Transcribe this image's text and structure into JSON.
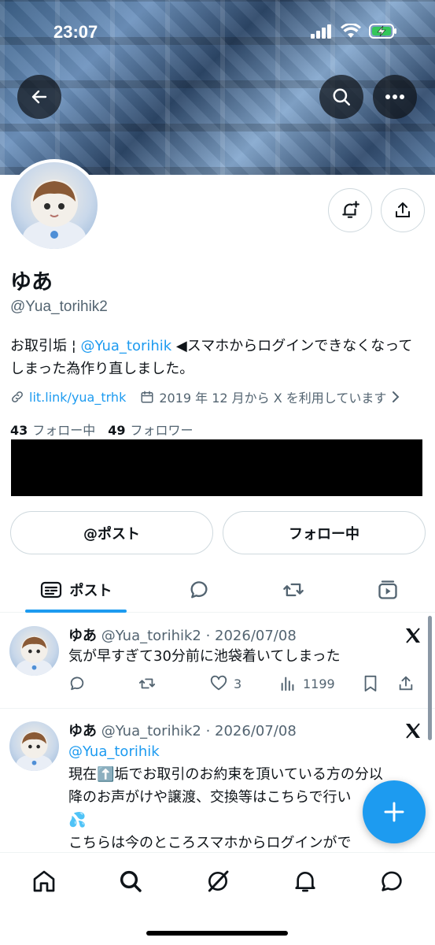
{
  "status_bar": {
    "time": "23:07"
  },
  "profile": {
    "display_name": "ゆあ",
    "handle": "@Yua_torihik2",
    "bio_prefix": "お取引垢 ¦ ",
    "bio_mention": "@Yua_torihik",
    "bio_suffix": " ◀スマホからログインできなくなってしまった為作り直しました。",
    "link_text": "lit.link/yua_trhk",
    "joined_text": "2019 年 12 月から X を利用しています",
    "following_count": "43",
    "following_label": "フォロー中",
    "followers_count": "49",
    "followers_label": "フォロワー"
  },
  "buttons": {
    "post_mention": "@ポスト",
    "following": "フォロー中"
  },
  "tabs": [
    {
      "label": "ポスト",
      "icon": "posts-icon",
      "active": true
    },
    {
      "label": "",
      "icon": "replies-icon"
    },
    {
      "label": "",
      "icon": "reposts-icon"
    },
    {
      "label": "",
      "icon": "media-icon"
    }
  ],
  "posts": [
    {
      "name": "ゆあ",
      "handle_date": "@Yua_torihik2 · 2026/07/08",
      "text": "気が早すぎて30分前に池袋着いてしまった",
      "replies": "",
      "reposts": "",
      "likes": "3",
      "views": "1199"
    },
    {
      "name": "ゆあ",
      "handle_date": "@Yua_torihik2 · 2026/07/08",
      "mention": "@Yua_torihik",
      "text_line1": "現在⬆️垢でお取引のお約束を頂いている方の分以",
      "text_line2": "降のお声がけや譲渡、交換等はこちらで行い",
      "text_line3": "💦",
      "text_line4": "こちらは今のところスマホからログインがで"
    }
  ],
  "colors": {
    "accent": "#1d9bf0",
    "text": "#0f1419",
    "muted": "#536471"
  }
}
